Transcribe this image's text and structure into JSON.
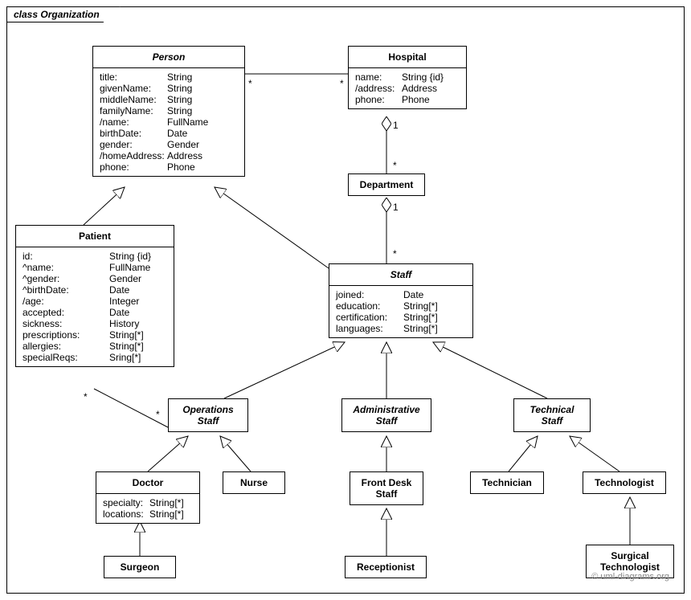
{
  "package": {
    "label": "class Organization"
  },
  "classes": {
    "person": {
      "name": "Person",
      "attrs": [
        {
          "n": "title:",
          "t": "String"
        },
        {
          "n": "givenName:",
          "t": "String"
        },
        {
          "n": "middleName:",
          "t": "String"
        },
        {
          "n": "familyName:",
          "t": "String"
        },
        {
          "n": "/name:",
          "t": "FullName"
        },
        {
          "n": "birthDate:",
          "t": "Date"
        },
        {
          "n": "gender:",
          "t": "Gender"
        },
        {
          "n": "/homeAddress:",
          "t": "Address"
        },
        {
          "n": "phone:",
          "t": "Phone"
        }
      ]
    },
    "hospital": {
      "name": "Hospital",
      "attrs": [
        {
          "n": "name:",
          "t": "String {id}"
        },
        {
          "n": "/address:",
          "t": "Address"
        },
        {
          "n": "phone:",
          "t": "Phone"
        }
      ]
    },
    "department": {
      "name": "Department"
    },
    "patient": {
      "name": "Patient",
      "attrs": [
        {
          "n": "id:",
          "t": "String {id}"
        },
        {
          "n": "^name:",
          "t": "FullName"
        },
        {
          "n": "^gender:",
          "t": "Gender"
        },
        {
          "n": "^birthDate:",
          "t": "Date"
        },
        {
          "n": "/age:",
          "t": "Integer"
        },
        {
          "n": "accepted:",
          "t": "Date"
        },
        {
          "n": "sickness:",
          "t": "History"
        },
        {
          "n": "prescriptions:",
          "t": "String[*]"
        },
        {
          "n": "allergies:",
          "t": "String[*]"
        },
        {
          "n": "specialReqs:",
          "t": "Sring[*]"
        }
      ]
    },
    "staff": {
      "name": "Staff",
      "attrs": [
        {
          "n": "joined:",
          "t": "Date"
        },
        {
          "n": "education:",
          "t": "String[*]"
        },
        {
          "n": "certification:",
          "t": "String[*]"
        },
        {
          "n": "languages:",
          "t": "String[*]"
        }
      ]
    },
    "operationsStaff": {
      "name": "Operations\nStaff"
    },
    "administrativeStaff": {
      "name": "Administrative\nStaff"
    },
    "technicalStaff": {
      "name": "Technical\nStaff"
    },
    "doctor": {
      "name": "Doctor",
      "attrs": [
        {
          "n": "specialty:",
          "t": "String[*]"
        },
        {
          "n": "locations:",
          "t": "String[*]"
        }
      ]
    },
    "nurse": {
      "name": "Nurse"
    },
    "frontDeskStaff": {
      "name": "Front Desk\nStaff"
    },
    "receptionist": {
      "name": "Receptionist"
    },
    "technician": {
      "name": "Technician"
    },
    "technologist": {
      "name": "Technologist"
    },
    "surgeon": {
      "name": "Surgeon"
    },
    "surgicalTechnologist": {
      "name": "Surgical\nTechnologist"
    }
  },
  "mult": {
    "personHospitalL": "*",
    "personHospitalR": "*",
    "hospDept1": "1",
    "hospDeptStar": "*",
    "deptStaff1": "1",
    "deptStaffStar": "*",
    "patientOpsStar1": "*",
    "patientOpsStar2": "*"
  },
  "watermark": "© uml-diagrams.org"
}
